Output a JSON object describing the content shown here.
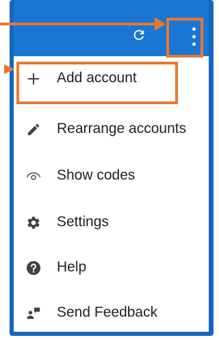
{
  "colors": {
    "app_bar": "#1976d2",
    "frame": "#1566c0",
    "highlight": "#e9782f",
    "icon": "#424242"
  },
  "app_bar": {
    "refresh_icon": "refresh-icon",
    "overflow_icon": "more-vert-icon"
  },
  "menu": {
    "items": [
      {
        "label": "Add account",
        "icon": "plus-icon",
        "highlighted": true
      },
      {
        "label": "Rearrange accounts",
        "icon": "pencil-icon",
        "highlighted": false
      },
      {
        "label": "Show codes",
        "icon": "eye-icon",
        "highlighted": false
      },
      {
        "label": "Settings",
        "icon": "gear-icon",
        "highlighted": false
      },
      {
        "label": "Help",
        "icon": "help-icon",
        "highlighted": false
      },
      {
        "label": "Send Feedback",
        "icon": "feedback-icon",
        "highlighted": false
      }
    ]
  }
}
